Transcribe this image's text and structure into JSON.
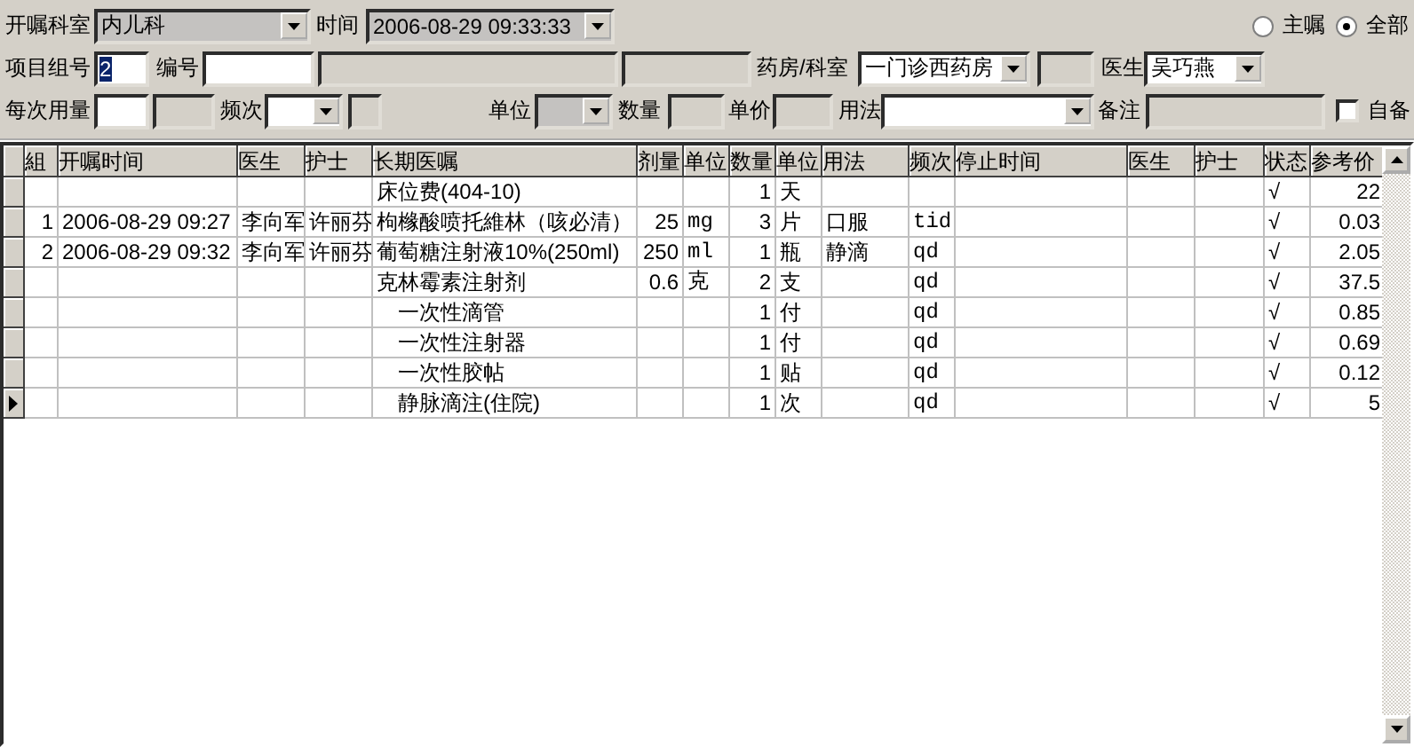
{
  "form_rows": [
    {
      "items": [
        {
          "kind": "label",
          "text": "开嘱科室"
        },
        {
          "kind": "select",
          "value": "内儿科",
          "disabled": true
        },
        {
          "kind": "label",
          "text": "时间"
        },
        {
          "kind": "select",
          "value": "2006-08-29 09:33:33",
          "disabled": true
        },
        {
          "kind": "radio",
          "text": "主嘱",
          "selected": false
        },
        {
          "kind": "radio",
          "text": "全部",
          "selected": true
        }
      ]
    },
    {
      "items": [
        {
          "kind": "label",
          "text": "项目组号"
        },
        {
          "kind": "input",
          "value": "2",
          "disabled": false,
          "highlighted": true
        },
        {
          "kind": "label",
          "text": "编号"
        },
        {
          "kind": "input",
          "disabled": false
        },
        {
          "kind": "input",
          "disabled": true
        },
        {
          "kind": "input",
          "disabled": true
        },
        {
          "kind": "label",
          "text": "药房/科室"
        },
        {
          "kind": "select",
          "value": "一门诊西药房",
          "disabled": false
        },
        {
          "kind": "input",
          "disabled": true
        },
        {
          "kind": "label",
          "text": "医生"
        },
        {
          "kind": "select",
          "value": "吴巧燕",
          "disabled": false
        }
      ]
    },
    {
      "items": [
        {
          "kind": "label",
          "text": "每次用量"
        },
        {
          "kind": "input",
          "disabled": false
        },
        {
          "kind": "input",
          "disabled": true
        },
        {
          "kind": "label",
          "text": "频次"
        },
        {
          "kind": "select",
          "disabled": false
        },
        {
          "kind": "input",
          "disabled": true
        },
        {
          "kind": "label",
          "text": "单位"
        },
        {
          "kind": "select",
          "disabled": true
        },
        {
          "kind": "label",
          "text": "数量"
        },
        {
          "kind": "input",
          "disabled": true
        },
        {
          "kind": "label",
          "text": "单价"
        },
        {
          "kind": "input",
          "disabled": true
        },
        {
          "kind": "label",
          "text": "用法"
        },
        {
          "kind": "select",
          "disabled": false
        },
        {
          "kind": "label",
          "text": "备注"
        },
        {
          "kind": "input",
          "disabled": true
        },
        {
          "kind": "checkbox",
          "text": "自备",
          "checked": false
        }
      ]
    }
  ],
  "table": {
    "columns": [
      "組",
      "开嘱时间",
      "医生",
      "护士",
      "长期医嘱",
      "剂量",
      "单位",
      "数量",
      "单位",
      "用法",
      "频次",
      "停止时间",
      "医生",
      "护士",
      "状态",
      "参考价"
    ],
    "rows": [
      {
        "selected": false,
        "order": "床位费(404-10)",
        "qty": "1",
        "unit": "天",
        "status": "√",
        "price": "22"
      },
      {
        "selected": false,
        "group": "1",
        "time": "2006-08-29 09:27",
        "doctor": "李向军",
        "nurse": "许丽芬",
        "order": "枸橼酸喷托維林（咳必清）",
        "dose": "25",
        "dose_unit": "mg",
        "qty": "3",
        "unit": "片",
        "usage": "口服",
        "freq": "tid",
        "status": "√",
        "price": "0.03"
      },
      {
        "selected": false,
        "group": "2",
        "time": "2006-08-29 09:32",
        "doctor": "李向军",
        "nurse": "许丽芬",
        "order": "葡萄糖注射液10%(250ml)",
        "dose": "250",
        "dose_unit": "ml",
        "qty": "1",
        "unit": "瓶",
        "usage": "静滴",
        "freq": "qd",
        "status": "√",
        "price": "2.05"
      },
      {
        "selected": false,
        "order": "克林霉素注射剂",
        "dose": "0.6",
        "dose_unit": "克",
        "qty": "2",
        "unit": "支",
        "freq": "qd",
        "status": "√",
        "price": "37.5",
        "children": [
          {
            "selected": false,
            "order": "一次性滴管",
            "qty": "1",
            "unit": "付",
            "freq": "qd",
            "status": "√",
            "price": "0.85"
          },
          {
            "selected": false,
            "order": "一次性注射器",
            "qty": "1",
            "unit": "付",
            "freq": "qd",
            "status": "√",
            "price": "0.69"
          },
          {
            "selected": false,
            "order": "一次性胶帖",
            "qty": "1",
            "unit": "贴",
            "freq": "qd",
            "status": "√",
            "price": "0.12"
          },
          {
            "selected": true,
            "order": "静脉滴注(住院)",
            "qty": "1",
            "unit": "次",
            "freq": "qd",
            "status": "√",
            "price": "5"
          }
        ]
      }
    ]
  }
}
